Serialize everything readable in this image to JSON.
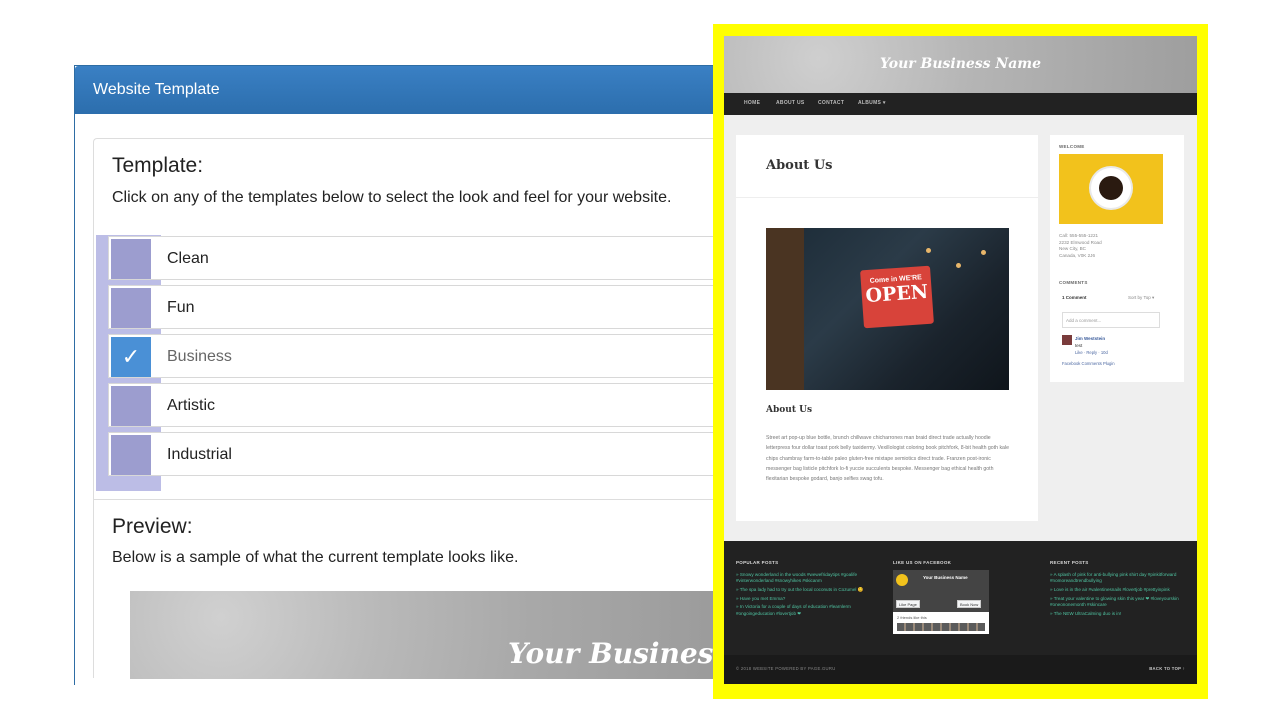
{
  "panel": {
    "title": "Website Template",
    "template_heading": "Template:",
    "template_desc": "Click on any of the templates below to select the look and feel for your website.",
    "templates": [
      {
        "label": "Clean",
        "selected": false
      },
      {
        "label": "Fun",
        "selected": false
      },
      {
        "label": "Business",
        "selected": true
      },
      {
        "label": "Artistic",
        "selected": false
      },
      {
        "label": "Industrial",
        "selected": false
      }
    ],
    "check_glyph": "✓",
    "preview_heading": "Preview:",
    "preview_desc": "Below is a sample of what the current template looks like.",
    "preview_title": "Your Business Name"
  },
  "site": {
    "brand": "Your Business Name",
    "nav": [
      "HOME",
      "ABOUT US",
      "CONTACT",
      "ALBUMS ▾"
    ],
    "page_title": "About Us",
    "photo_sign_small": "Come in WE'RE",
    "photo_sign_big": "OPEN",
    "section_title": "About Us",
    "body_text": "Street art pop-up blue bottle, brunch chillwave chicharrones man braid direct trade actually hoodie letterpress four dollar toast pork belly taxidermy. Vexillologist coloring book pitchfork, 8-bit health goth kale chips chambray farm-to-table paleo gluten-free mixtape semiotics direct trade. Franzen post-ironic messenger bag listicle pitchfork lo-fi yuccie succulents bespoke. Messenger bag ethical health goth flexitarian bespoke godard, banjo selfies swag tofu.",
    "sidebar": {
      "welcome_label": "WELCOME",
      "address": [
        "Call: 555-555-1221",
        "2232 Elmwood Road",
        "New City, BC",
        "Canada, V0K 2J6"
      ],
      "comments_label": "COMMENTS",
      "comment_count": "1 Comment",
      "sort_label": "Sort by",
      "sort_value": "Top ▾",
      "comment_placeholder": "Add a comment...",
      "commenter": "Jim Weststein",
      "comment_text": "test",
      "comment_actions": "Like · Reply · 10d",
      "plugin_label": "Facebook Comments Plugin"
    },
    "footer": {
      "col1_title": "POPULAR POSTS",
      "col1_items": [
        "» Snowy wonderland in the woods #wewefridaytips #goalife #vinterwonderland #snowyhikes #skicanm",
        "» The spa lady had to try out the local coconuts in Cozumel 😊",
        "» Have you met Emma?",
        "» In Victoria for a couple of days of education #learnlerm #ongoingeducation #lovertjob ❤"
      ],
      "col2_title": "LIKE US ON FACEBOOK",
      "fb_page_name": "Your Business Name",
      "fb_like_btn": "Like Page",
      "fb_book_btn": "Book Now",
      "fb_likes": "2 friends like this",
      "col3_title": "RECENT POSTS",
      "col3_items": [
        "» A splash of pink for anti-bullying pink shirt day #pinkitforward #nomoreandtrendbullying",
        "» Love is in the air #valentinesnails #lovertjob #prettyinpink",
        "» Treat your valentine to glowing skin this year ❤ #loveyourskin #oneononemonth #skincare",
        "» The NEW UltraCalming duo is in!"
      ]
    },
    "copyright": "© 2018 WEBSITE POWERED BY PAGE.GURU",
    "back_to_top": "BACK TO TOP ↑"
  }
}
